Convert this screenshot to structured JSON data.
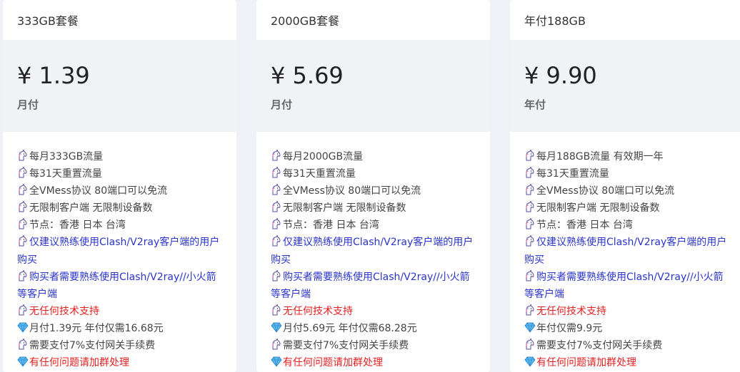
{
  "plans": [
    {
      "title": "333GB套餐",
      "price": "¥ 1.39",
      "period": "月付",
      "features": [
        {
          "icon": "unicorn-icon",
          "text": "每月333GB流量",
          "tone": "dark"
        },
        {
          "icon": "unicorn-icon",
          "text": "每31天重置流量",
          "tone": "dark"
        },
        {
          "icon": "unicorn-icon",
          "text": "全VMess协议 80端口可以免流",
          "tone": "dark"
        },
        {
          "icon": "unicorn-icon",
          "text": "无限制客户端 无限制设备数",
          "tone": "dark"
        },
        {
          "icon": "unicorn-icon",
          "text": "节点：香港 日本 台湾",
          "tone": "dark"
        },
        {
          "icon": "unicorn-icon",
          "text": "仅建议熟练使用Clash/V2ray客户端的用户购买",
          "tone": "blue"
        },
        {
          "icon": "unicorn-icon",
          "text": "购买者需要熟练使用Clash/V2ray//小火箭等客户端",
          "tone": "blue"
        },
        {
          "icon": "unicorn-icon",
          "text": "无任何技术支持",
          "tone": "red"
        },
        {
          "icon": "diamond-icon",
          "text": "月付1.39元 年付仅需16.68元",
          "tone": "dark"
        },
        {
          "icon": "unicorn-icon",
          "text": "需要支付7%支付网关手续费",
          "tone": "dark"
        },
        {
          "icon": "diamond-icon",
          "text": "有任何问题请加群处理",
          "tone": "red"
        }
      ]
    },
    {
      "title": "2000GB套餐",
      "price": "¥ 5.69",
      "period": "月付",
      "features": [
        {
          "icon": "unicorn-icon",
          "text": "每月2000GB流量",
          "tone": "dark"
        },
        {
          "icon": "unicorn-icon",
          "text": "每31天重置流量",
          "tone": "dark"
        },
        {
          "icon": "unicorn-icon",
          "text": "全VMess协议 80端口可以免流",
          "tone": "dark"
        },
        {
          "icon": "unicorn-icon",
          "text": "无限制客户端 无限制设备数",
          "tone": "dark"
        },
        {
          "icon": "unicorn-icon",
          "text": "节点：香港 日本 台湾",
          "tone": "dark"
        },
        {
          "icon": "unicorn-icon",
          "text": "仅建议熟练使用Clash/V2ray客户端的用户购买",
          "tone": "blue"
        },
        {
          "icon": "unicorn-icon",
          "text": "购买者需要熟练使用Clash/V2ray//小火箭等客户端",
          "tone": "blue"
        },
        {
          "icon": "unicorn-icon",
          "text": "无任何技术支持",
          "tone": "red"
        },
        {
          "icon": "diamond-icon",
          "text": "月付5.69元 年付仅需68.28元",
          "tone": "dark"
        },
        {
          "icon": "unicorn-icon",
          "text": "需要支付7%支付网关手续费",
          "tone": "dark"
        },
        {
          "icon": "diamond-icon",
          "text": "有任何问题请加群处理",
          "tone": "red"
        }
      ]
    },
    {
      "title": "年付188GB",
      "price": "¥ 9.90",
      "period": "年付",
      "features": [
        {
          "icon": "unicorn-icon",
          "text": "每月188GB流量 有效期一年",
          "tone": "dark"
        },
        {
          "icon": "unicorn-icon",
          "text": "每31天重置流量",
          "tone": "dark"
        },
        {
          "icon": "unicorn-icon",
          "text": "全VMess协议 80端口可以免流",
          "tone": "dark"
        },
        {
          "icon": "unicorn-icon",
          "text": "无限制客户端 无限制设备数",
          "tone": "dark"
        },
        {
          "icon": "unicorn-icon",
          "text": "节点：香港 日本 台湾",
          "tone": "dark"
        },
        {
          "icon": "unicorn-icon",
          "text": "仅建议熟练使用Clash/V2ray客户端的用户购买",
          "tone": "blue"
        },
        {
          "icon": "unicorn-icon",
          "text": "购买者需要熟练使用Clash/V2ray//小火箭等客户端",
          "tone": "blue"
        },
        {
          "icon": "unicorn-icon",
          "text": "无任何技术支持",
          "tone": "red"
        },
        {
          "icon": "diamond-icon",
          "text": "年付仅需9.9元",
          "tone": "dark"
        },
        {
          "icon": "unicorn-icon",
          "text": "需要支付7%支付网关手续费",
          "tone": "dark"
        },
        {
          "icon": "diamond-icon",
          "text": "有任何问题请加群处理",
          "tone": "red"
        }
      ]
    }
  ],
  "colors": {
    "blue_text": "#2a35c9",
    "red_text": "#e02020",
    "price_band": "#f0f2f5",
    "page_bg": "#eef1f6"
  }
}
